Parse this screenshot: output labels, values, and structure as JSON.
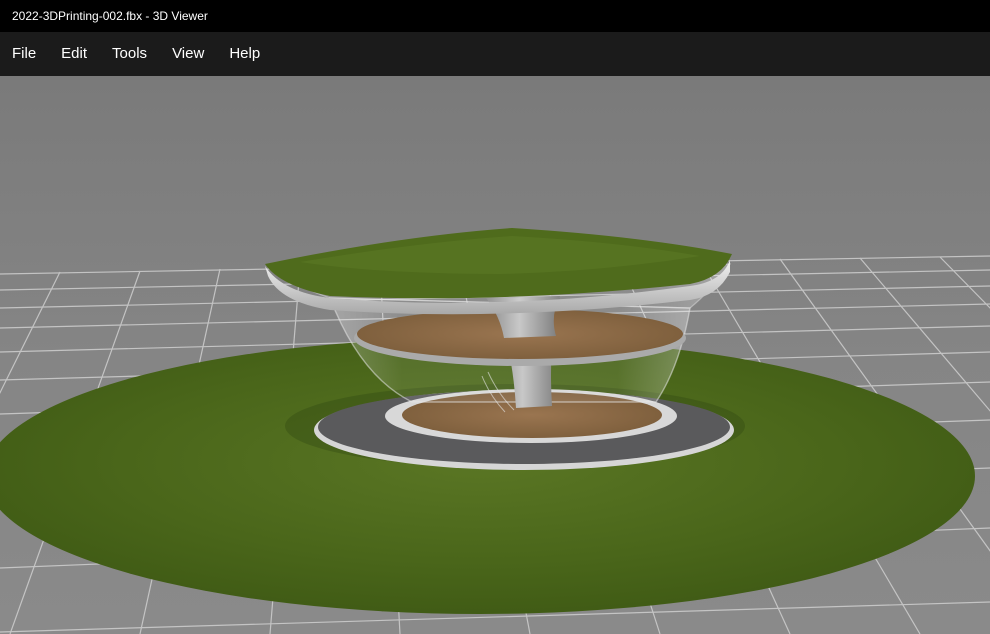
{
  "window": {
    "title": "2022-3DPrinting-002.fbx - 3D Viewer"
  },
  "menu": {
    "items": [
      {
        "key": "file",
        "label": "File"
      },
      {
        "key": "edit",
        "label": "Edit"
      },
      {
        "key": "tools",
        "label": "Tools"
      },
      {
        "key": "view",
        "label": "View"
      },
      {
        "key": "help",
        "label": "Help"
      }
    ]
  },
  "viewport": {
    "background_color": "#7c7c7c",
    "grid_color": "#c8c8c8",
    "grass_color": "#4f6b1c",
    "paving_color": "#5a5a5c",
    "wood_color": "#8a6a44",
    "glass_color": "#d9dde0"
  }
}
